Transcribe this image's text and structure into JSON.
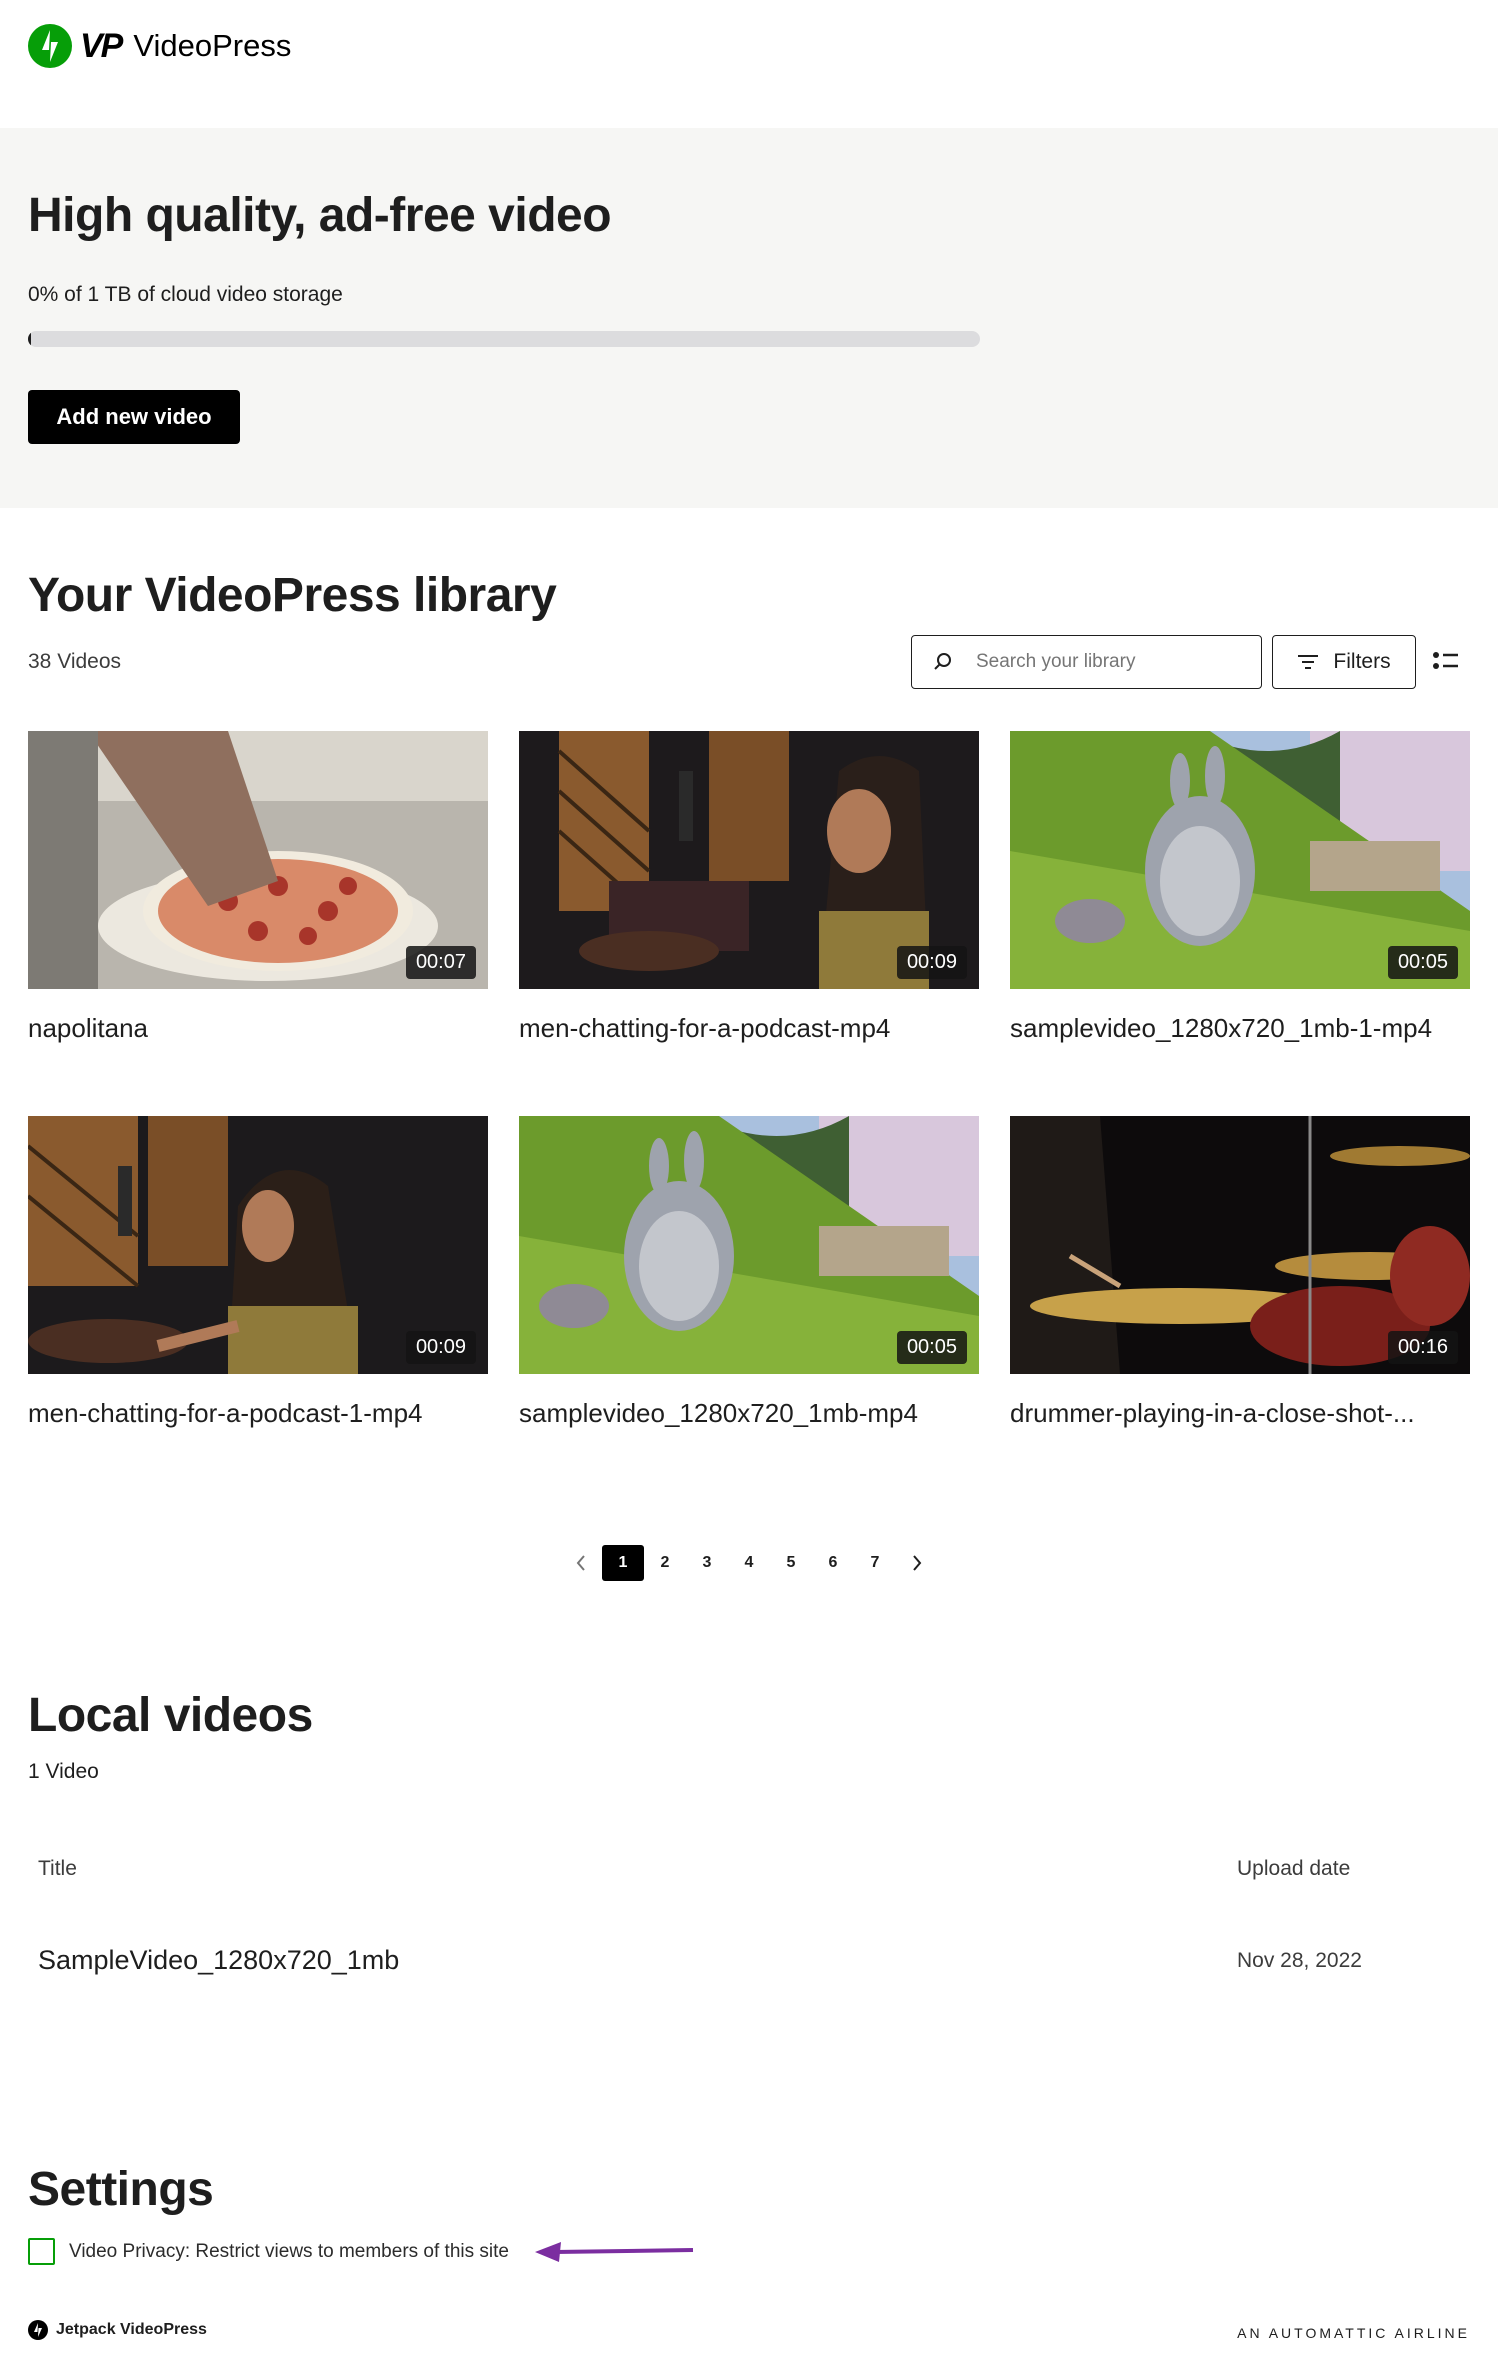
{
  "brand": {
    "name": "VideoPress",
    "mark": "VP"
  },
  "hero": {
    "title": "High quality, ad-free video",
    "storage_text": "0% of 1 TB of cloud video storage",
    "storage_used_fraction": 0.003,
    "add_button": "Add new video"
  },
  "library": {
    "title": "Your VideoPress library",
    "count": "38 Videos",
    "search_placeholder": "Search your library",
    "filters_label": "Filters",
    "videos": [
      {
        "title": "napolitana",
        "duration": "00:07",
        "thumb": "pizza"
      },
      {
        "title": "men-chatting-for-a-podcast-mp4",
        "duration": "00:09",
        "thumb": "podcast-man"
      },
      {
        "title": "samplevideo_1280x720_1mb-1-mp4",
        "duration": "00:05",
        "thumb": "bunny"
      },
      {
        "title": "men-chatting-for-a-podcast-1-mp4",
        "duration": "00:09",
        "thumb": "podcast-woman"
      },
      {
        "title": "samplevideo_1280x720_1mb-mp4",
        "duration": "00:05",
        "thumb": "bunny"
      },
      {
        "title": "drummer-playing-in-a-close-shot-...",
        "duration": "00:16",
        "thumb": "drums"
      }
    ],
    "pagination": {
      "pages": [
        "1",
        "2",
        "3",
        "4",
        "5",
        "6",
        "7"
      ],
      "current": "1"
    }
  },
  "local": {
    "title": "Local videos",
    "count": "1 Video",
    "columns": {
      "title": "Title",
      "date": "Upload date"
    },
    "rows": [
      {
        "title": "SampleVideo_1280x720_1mb",
        "date": "Nov 28, 2022"
      }
    ]
  },
  "settings": {
    "title": "Settings",
    "privacy_label": "Video Privacy: Restrict views to members of this site",
    "privacy_checked": false,
    "annotation_color": "#7b2ea0"
  },
  "footer": {
    "left": "Jetpack VideoPress",
    "right": "AN AUTOMATTIC AIRLINE"
  },
  "colors": {
    "jetpack_green": "#069e08",
    "hero_bg": "#f6f6f4",
    "button_black": "#000000"
  }
}
